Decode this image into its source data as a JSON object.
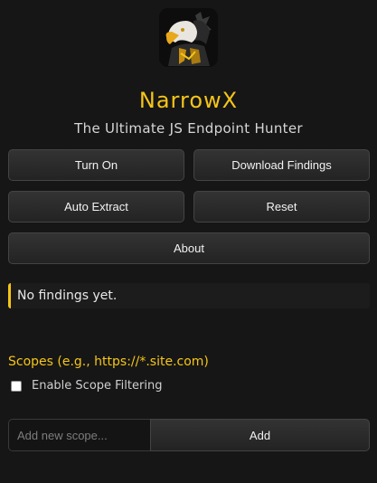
{
  "app": {
    "title": "NarrowX",
    "subtitle": "The Ultimate JS Endpoint Hunter",
    "logo_icon": "eagle-samurai-logo-icon",
    "accent_color": "#f5c518"
  },
  "buttons": {
    "turn_on": "Turn On",
    "download_findings": "Download Findings",
    "auto_extract": "Auto Extract",
    "reset": "Reset",
    "about": "About"
  },
  "findings": {
    "status_text": "No findings yet."
  },
  "scopes": {
    "heading": "Scopes (e.g., https://*.site.com)",
    "enable_filtering_label": "Enable Scope Filtering",
    "enable_filtering_checked": false,
    "input_value": "",
    "input_placeholder": "Add new scope...",
    "add_button_label": "Add"
  }
}
